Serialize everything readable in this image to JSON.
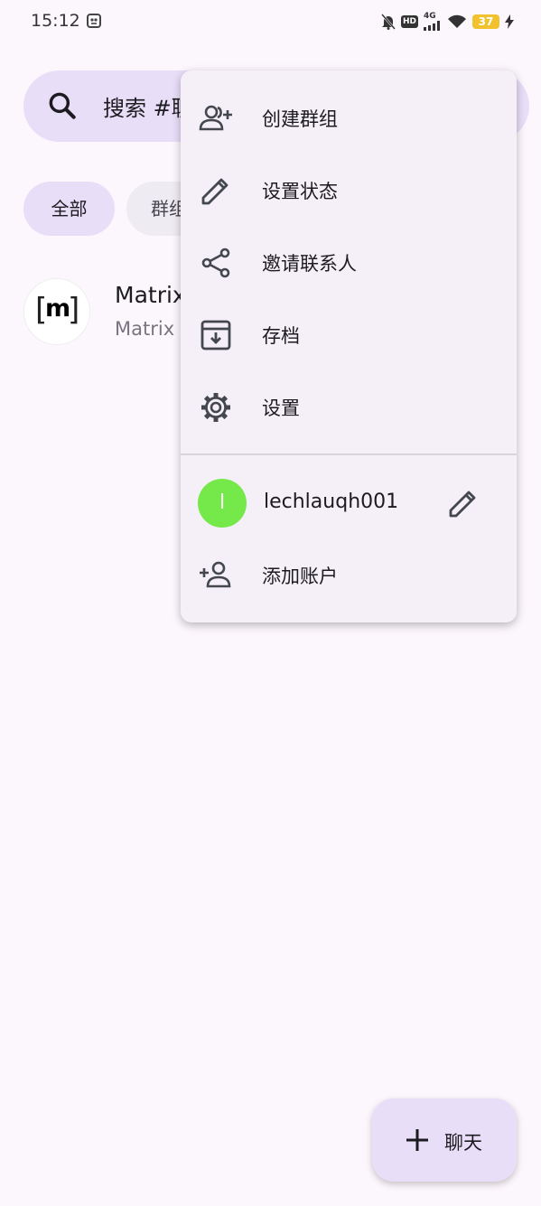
{
  "status_bar": {
    "time": "15:12",
    "hd_badge": "HD",
    "network": "4G",
    "battery": "37",
    "icons": [
      "app-notification-icon",
      "mute-bell-icon",
      "signal-icon",
      "wifi-icon",
      "charging-icon"
    ]
  },
  "search": {
    "text": "搜索 #聊天"
  },
  "filters": {
    "chips": [
      {
        "label": "全部",
        "selected": true
      },
      {
        "label": "群组",
        "selected": false
      }
    ]
  },
  "chat_list": [
    {
      "name": "Matrix",
      "subtitle": "Matrix",
      "avatar_letter": "m"
    }
  ],
  "menu": {
    "items": [
      {
        "label": "创建群组",
        "icon": "create-group-icon"
      },
      {
        "label": "设置状态",
        "icon": "pencil-icon"
      },
      {
        "label": "邀请联系人",
        "icon": "share-icon"
      },
      {
        "label": "存档",
        "icon": "archive-icon"
      },
      {
        "label": "设置",
        "icon": "gear-icon"
      }
    ],
    "account": {
      "initial": "l",
      "name": "lechlauqh001",
      "avatar_color": "#75e84a"
    },
    "add_account": "添加账户"
  },
  "fab": {
    "label": "聊天",
    "icon": "plus-icon"
  },
  "colors": {
    "background": "#fcf7fd",
    "accent_container": "#e9def8",
    "menu_surface": "#f5f0f7"
  }
}
